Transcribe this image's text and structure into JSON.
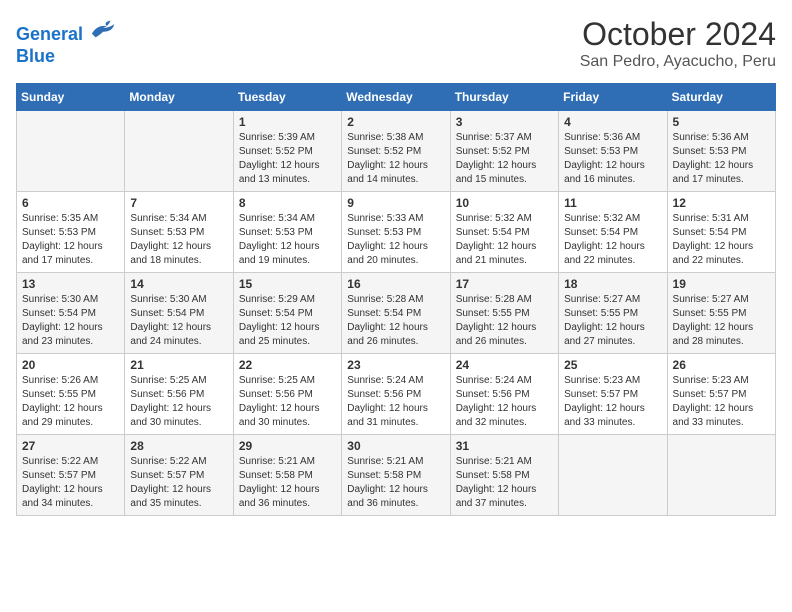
{
  "logo": {
    "line1": "General",
    "line2": "Blue"
  },
  "header": {
    "month": "October 2024",
    "location": "San Pedro, Ayacucho, Peru"
  },
  "weekdays": [
    "Sunday",
    "Monday",
    "Tuesday",
    "Wednesday",
    "Thursday",
    "Friday",
    "Saturday"
  ],
  "weeks": [
    [
      {
        "day": "",
        "info": ""
      },
      {
        "day": "",
        "info": ""
      },
      {
        "day": "1",
        "info": "Sunrise: 5:39 AM\nSunset: 5:52 PM\nDaylight: 12 hours\nand 13 minutes."
      },
      {
        "day": "2",
        "info": "Sunrise: 5:38 AM\nSunset: 5:52 PM\nDaylight: 12 hours\nand 14 minutes."
      },
      {
        "day": "3",
        "info": "Sunrise: 5:37 AM\nSunset: 5:52 PM\nDaylight: 12 hours\nand 15 minutes."
      },
      {
        "day": "4",
        "info": "Sunrise: 5:36 AM\nSunset: 5:53 PM\nDaylight: 12 hours\nand 16 minutes."
      },
      {
        "day": "5",
        "info": "Sunrise: 5:36 AM\nSunset: 5:53 PM\nDaylight: 12 hours\nand 17 minutes."
      }
    ],
    [
      {
        "day": "6",
        "info": "Sunrise: 5:35 AM\nSunset: 5:53 PM\nDaylight: 12 hours\nand 17 minutes."
      },
      {
        "day": "7",
        "info": "Sunrise: 5:34 AM\nSunset: 5:53 PM\nDaylight: 12 hours\nand 18 minutes."
      },
      {
        "day": "8",
        "info": "Sunrise: 5:34 AM\nSunset: 5:53 PM\nDaylight: 12 hours\nand 19 minutes."
      },
      {
        "day": "9",
        "info": "Sunrise: 5:33 AM\nSunset: 5:53 PM\nDaylight: 12 hours\nand 20 minutes."
      },
      {
        "day": "10",
        "info": "Sunrise: 5:32 AM\nSunset: 5:54 PM\nDaylight: 12 hours\nand 21 minutes."
      },
      {
        "day": "11",
        "info": "Sunrise: 5:32 AM\nSunset: 5:54 PM\nDaylight: 12 hours\nand 22 minutes."
      },
      {
        "day": "12",
        "info": "Sunrise: 5:31 AM\nSunset: 5:54 PM\nDaylight: 12 hours\nand 22 minutes."
      }
    ],
    [
      {
        "day": "13",
        "info": "Sunrise: 5:30 AM\nSunset: 5:54 PM\nDaylight: 12 hours\nand 23 minutes."
      },
      {
        "day": "14",
        "info": "Sunrise: 5:30 AM\nSunset: 5:54 PM\nDaylight: 12 hours\nand 24 minutes."
      },
      {
        "day": "15",
        "info": "Sunrise: 5:29 AM\nSunset: 5:54 PM\nDaylight: 12 hours\nand 25 minutes."
      },
      {
        "day": "16",
        "info": "Sunrise: 5:28 AM\nSunset: 5:54 PM\nDaylight: 12 hours\nand 26 minutes."
      },
      {
        "day": "17",
        "info": "Sunrise: 5:28 AM\nSunset: 5:55 PM\nDaylight: 12 hours\nand 26 minutes."
      },
      {
        "day": "18",
        "info": "Sunrise: 5:27 AM\nSunset: 5:55 PM\nDaylight: 12 hours\nand 27 minutes."
      },
      {
        "day": "19",
        "info": "Sunrise: 5:27 AM\nSunset: 5:55 PM\nDaylight: 12 hours\nand 28 minutes."
      }
    ],
    [
      {
        "day": "20",
        "info": "Sunrise: 5:26 AM\nSunset: 5:55 PM\nDaylight: 12 hours\nand 29 minutes."
      },
      {
        "day": "21",
        "info": "Sunrise: 5:25 AM\nSunset: 5:56 PM\nDaylight: 12 hours\nand 30 minutes."
      },
      {
        "day": "22",
        "info": "Sunrise: 5:25 AM\nSunset: 5:56 PM\nDaylight: 12 hours\nand 30 minutes."
      },
      {
        "day": "23",
        "info": "Sunrise: 5:24 AM\nSunset: 5:56 PM\nDaylight: 12 hours\nand 31 minutes."
      },
      {
        "day": "24",
        "info": "Sunrise: 5:24 AM\nSunset: 5:56 PM\nDaylight: 12 hours\nand 32 minutes."
      },
      {
        "day": "25",
        "info": "Sunrise: 5:23 AM\nSunset: 5:57 PM\nDaylight: 12 hours\nand 33 minutes."
      },
      {
        "day": "26",
        "info": "Sunrise: 5:23 AM\nSunset: 5:57 PM\nDaylight: 12 hours\nand 33 minutes."
      }
    ],
    [
      {
        "day": "27",
        "info": "Sunrise: 5:22 AM\nSunset: 5:57 PM\nDaylight: 12 hours\nand 34 minutes."
      },
      {
        "day": "28",
        "info": "Sunrise: 5:22 AM\nSunset: 5:57 PM\nDaylight: 12 hours\nand 35 minutes."
      },
      {
        "day": "29",
        "info": "Sunrise: 5:21 AM\nSunset: 5:58 PM\nDaylight: 12 hours\nand 36 minutes."
      },
      {
        "day": "30",
        "info": "Sunrise: 5:21 AM\nSunset: 5:58 PM\nDaylight: 12 hours\nand 36 minutes."
      },
      {
        "day": "31",
        "info": "Sunrise: 5:21 AM\nSunset: 5:58 PM\nDaylight: 12 hours\nand 37 minutes."
      },
      {
        "day": "",
        "info": ""
      },
      {
        "day": "",
        "info": ""
      }
    ]
  ]
}
